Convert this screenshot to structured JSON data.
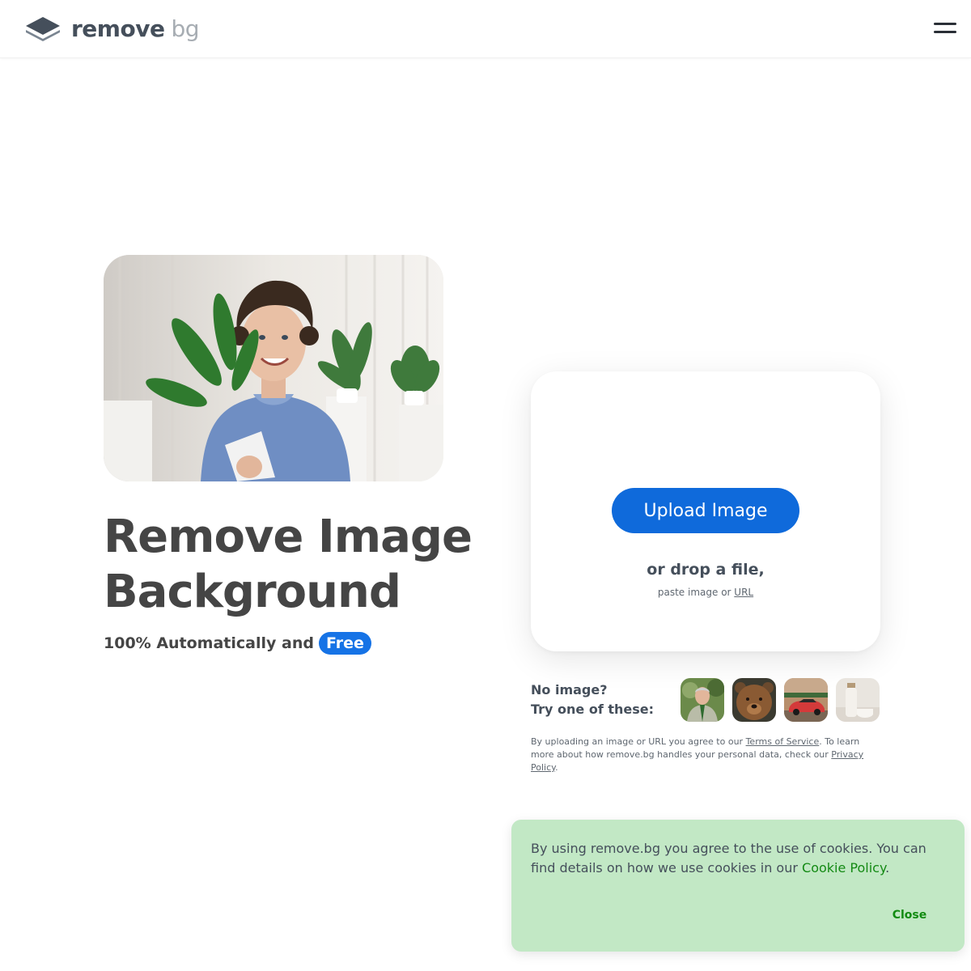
{
  "header": {
    "logo_main": "remove",
    "logo_sub": "bg"
  },
  "hero": {
    "title_line1": "Remove Image",
    "title_line2": "Background",
    "subtitle": "100% Automatically and",
    "badge": "Free"
  },
  "upload": {
    "button_label": "Upload Image",
    "drop_text": "or drop a file,",
    "paste_prefix": "paste image or",
    "url_link": "URL"
  },
  "samples": {
    "line1": "No image?",
    "line2": "Try one of these:"
  },
  "terms": {
    "part1": "By uploading an image or URL you agree to our",
    "tos_link": "Terms of Service",
    "part2": ". To learn more about how remove.bg handles your personal data, check our",
    "privacy_link": "Privacy Policy",
    "part3": "."
  },
  "cookie": {
    "text": "By using remove.bg you agree to the use of cookies. You can find details on how we use cookies in our",
    "link": "Cookie Policy",
    "end": ".",
    "close": "Close"
  },
  "colors": {
    "primary": "#0f6adb",
    "badge": "#1673e6",
    "heading": "#454545",
    "cookie_bg": "#c2e8c5",
    "cookie_link": "#148a14"
  }
}
